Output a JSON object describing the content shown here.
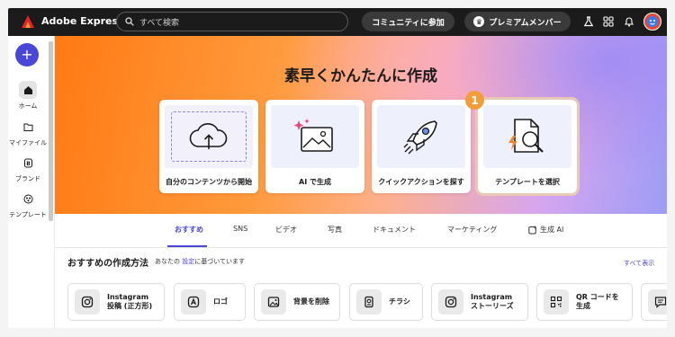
{
  "topbar": {
    "app_name": "Adobe Express",
    "search_placeholder": "すべて検索",
    "community_label": "コミュニティに参加",
    "premium_label": "プレミアムメンバー",
    "brand_color": "#e8202a"
  },
  "sidebar": {
    "create_label": "+",
    "items": [
      {
        "label": "ホーム",
        "icon": "home-icon",
        "active": true
      },
      {
        "label": "マイファイル",
        "icon": "folder-icon"
      },
      {
        "label": "ブランド",
        "icon": "brand-icon"
      },
      {
        "label": "テンプレート",
        "icon": "template-icon"
      }
    ]
  },
  "hero": {
    "title": "素早くかんたんに作成",
    "cards": [
      {
        "label": "自分のコンテンツから開始",
        "icon": "cloud-upload-icon"
      },
      {
        "label": "AI で生成",
        "icon": "ai-image-icon"
      },
      {
        "label": "クイックアクションを探す",
        "icon": "rocket-icon"
      },
      {
        "label": "テンプレートを選択",
        "icon": "template-search-icon"
      }
    ],
    "step_badge": "1"
  },
  "tabs": [
    {
      "label": "おすすめ",
      "active": true
    },
    {
      "label": "SNS"
    },
    {
      "label": "ビデオ"
    },
    {
      "label": "写真"
    },
    {
      "label": "ドキュメント"
    },
    {
      "label": "マーケティング"
    },
    {
      "label": "生成 AI"
    }
  ],
  "recommended": {
    "title": "おすすめの作成方法",
    "subtitle_prefix": "あなたの",
    "subtitle_link": "設定",
    "subtitle_suffix": "に基づいています",
    "show_all": "すべて表示",
    "items": [
      {
        "label": "Instagram\n投稿 (正方形)",
        "icon": "instagram-icon"
      },
      {
        "label": "ロゴ",
        "icon": "logo-icon"
      },
      {
        "label": "背景を削除",
        "icon": "remove-background-icon"
      },
      {
        "label": "チラシ",
        "icon": "flyer-icon"
      },
      {
        "label": "Instagram\nストーリーズ",
        "icon": "instagram-icon"
      },
      {
        "label": "QR コードを\n生成",
        "icon": "qr-code-icon"
      },
      {
        "label": "",
        "icon": "caption-icon"
      }
    ]
  }
}
